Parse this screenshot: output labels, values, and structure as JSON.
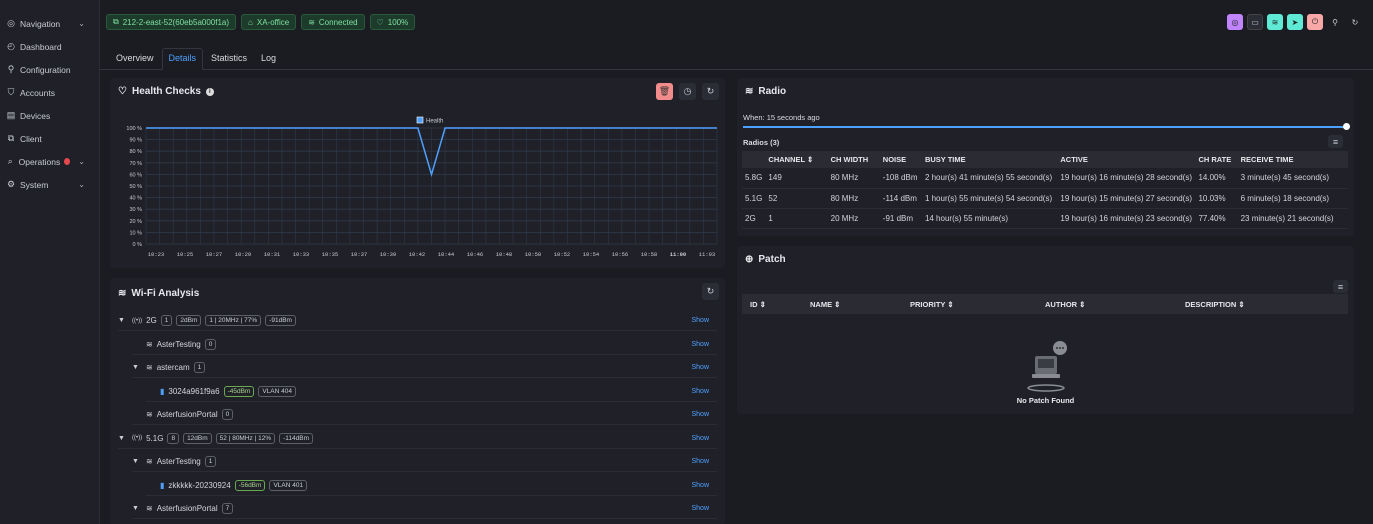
{
  "sidebar": {
    "items": [
      {
        "icon": "compass",
        "label": "Navigation",
        "chevron": true
      },
      {
        "icon": "dashboard",
        "label": "Dashboard"
      },
      {
        "icon": "wrench",
        "label": "Configuration"
      },
      {
        "icon": "shield",
        "label": "Accounts"
      },
      {
        "icon": "devices",
        "label": "Devices"
      },
      {
        "icon": "client",
        "label": "Client"
      },
      {
        "icon": "search",
        "label": "Operations",
        "badge": true,
        "chevron": true
      },
      {
        "icon": "gear",
        "label": "System",
        "chevron": true
      }
    ]
  },
  "topbar": {
    "device": "212-2-east-52(60eb5a000f1a)",
    "site": "XA-office",
    "status": "Connected",
    "health": "100%"
  },
  "tabs": [
    "Overview",
    "Details",
    "Statistics",
    "Log"
  ],
  "health": {
    "title": "Health Checks",
    "legend": "Health",
    "chart_data": {
      "type": "line",
      "series": [
        {
          "name": "Health",
          "values": [
            100,
            100,
            100,
            100,
            100,
            100,
            100,
            100,
            100,
            100,
            100,
            100,
            100,
            100,
            100,
            100,
            100,
            100,
            100,
            100,
            100,
            60,
            100,
            100,
            100,
            100,
            100,
            100,
            100,
            100,
            100,
            100,
            100,
            100,
            100,
            100,
            100,
            100,
            100,
            100,
            100,
            100,
            100
          ]
        }
      ],
      "x": [
        "10:23",
        "10:25",
        "10:27",
        "10:29",
        "10:31",
        "10:33",
        "10:35",
        "10:37",
        "10:39",
        "10:42",
        "10:44",
        "10:46",
        "10:48",
        "10:50",
        "10:52",
        "10:54",
        "10:56",
        "10:58",
        "11:00",
        "11:03"
      ],
      "y_ticks": [
        "100 %",
        "90 %",
        "80 %",
        "70 %",
        "60 %",
        "50 %",
        "40 %",
        "30 %",
        "20 %",
        "10 %",
        "0 %"
      ],
      "ylim": [
        0,
        100
      ],
      "grid": true,
      "legend_position": "top"
    }
  },
  "radio": {
    "title": "Radio",
    "when": "When: 15 seconds ago",
    "count_label": "Radios (3)",
    "columns": [
      "",
      "CHANNEL",
      "CH WIDTH",
      "NOISE",
      "BUSY TIME",
      "ACTIVE",
      "CH RATE",
      "RECEIVE TIME"
    ],
    "rows": [
      [
        "5.8G",
        "149",
        "80 MHz",
        "-108 dBm",
        "2 hour(s) 41 minute(s) 55 second(s)",
        "19 hour(s) 16 minute(s) 28 second(s)",
        "14.00%",
        "3 minute(s) 45 second(s)"
      ],
      [
        "5.1G",
        "52",
        "80 MHz",
        "-114 dBm",
        "1 hour(s) 55 minute(s) 54 second(s)",
        "19 hour(s) 15 minute(s) 27 second(s)",
        "10.03%",
        "6 minute(s) 18 second(s)"
      ],
      [
        "2G",
        "1",
        "20 MHz",
        "-91 dBm",
        "14 hour(s) 55 minute(s)",
        "19 hour(s) 16 minute(s) 23 second(s)",
        "77.40%",
        "23 minute(s) 21 second(s)"
      ]
    ]
  },
  "patch": {
    "title": "Patch",
    "columns": [
      "ID",
      "NAME",
      "PRIORITY",
      "AUTHOR",
      "DESCRIPTION"
    ],
    "empty": "No Patch Found"
  },
  "wifi": {
    "title": "Wi-Fi Analysis",
    "show": "Show",
    "rows": [
      {
        "indent": 0,
        "expand": true,
        "name": "2G",
        "chips": [
          "1",
          "2dBm",
          "1 | 20MHz | 77%",
          "-91dBm"
        ]
      },
      {
        "indent": 1,
        "expand": false,
        "name": "AsterTesting",
        "chips": [
          "0"
        ]
      },
      {
        "indent": 1,
        "expand": true,
        "name": "astercam",
        "chips": [
          "1"
        ]
      },
      {
        "indent": 2,
        "expand": false,
        "name": "3024a961f9a6",
        "chips": [
          "-45dBm",
          "VLAN 404"
        ]
      },
      {
        "indent": 1,
        "expand": false,
        "name": "AsterfusionPortal",
        "chips": [
          "0"
        ]
      },
      {
        "indent": 0,
        "expand": true,
        "name": "5.1G",
        "chips": [
          "8",
          "12dBm",
          "52 | 80MHz | 12%",
          "-114dBm"
        ]
      },
      {
        "indent": 1,
        "expand": true,
        "name": "AsterTesting",
        "chips": [
          "1"
        ]
      },
      {
        "indent": 2,
        "expand": false,
        "name": "zkkkkk-20230924",
        "chips": [
          "-56dBm",
          "VLAN 401"
        ]
      },
      {
        "indent": 1,
        "expand": true,
        "name": "AsterfusionPortal",
        "chips": [
          "7"
        ]
      }
    ]
  },
  "colors": {
    "accent": "#4ea0ff",
    "green": "#7fe0a2",
    "danger": "#f28b8b"
  }
}
